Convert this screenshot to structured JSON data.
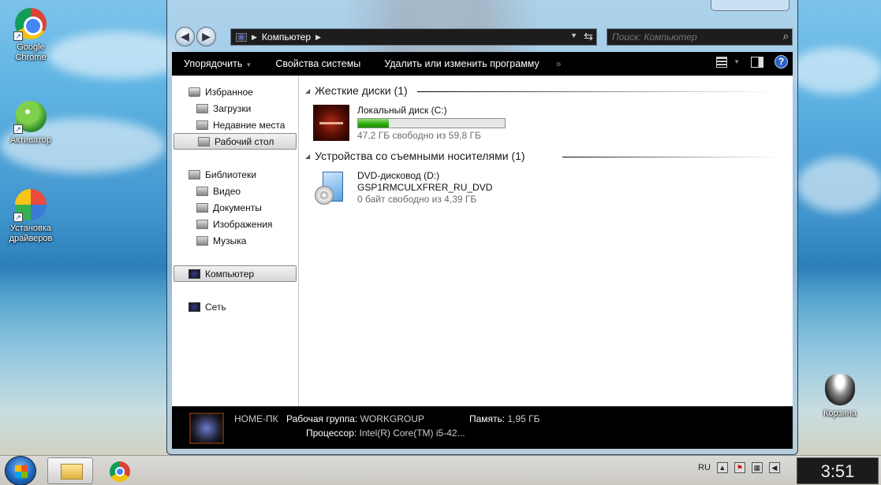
{
  "desktop": {
    "icons": [
      {
        "label": "Google Chrome",
        "icon": "chrome-icon"
      },
      {
        "label": "Активатор",
        "icon": "activator-icon"
      },
      {
        "label": "Установка драйверов",
        "icon": "driver-install-icon"
      },
      {
        "label": "Корзина",
        "icon": "recycle-bin-icon"
      }
    ]
  },
  "window": {
    "address": {
      "crumb": "Компьютер",
      "search_placeholder": "Поиск: Компьютер"
    },
    "toolbar": {
      "organize": "Упорядочить",
      "system_properties": "Свойства системы",
      "uninstall": "Удалить или изменить программу",
      "more": "»"
    },
    "nav": {
      "favorites": "Избранное",
      "downloads": "Загрузки",
      "recent": "Недавние места",
      "desktop": "Рабочий стол",
      "libraries": "Библиотеки",
      "video": "Видео",
      "documents": "Документы",
      "images": "Изображения",
      "music": "Музыка",
      "computer": "Компьютер",
      "network": "Сеть"
    },
    "groups": {
      "hdd_header": "Жесткие диски (1)",
      "removable_header": "Устройства со съемными носителями (1)"
    },
    "drives": {
      "c": {
        "name": "Локальный диск (C:)",
        "free": "47,2 ГБ свободно из 59,8 ГБ",
        "used_fraction": 0.21
      },
      "d": {
        "name": "DVD-дисковод (D:)",
        "label": "GSP1RMCULXFRER_RU_DVD",
        "free": "0 байт свободно из 4,39 ГБ"
      }
    },
    "details": {
      "pc_name": "HOME-ПК",
      "workgroup_label": "Рабочая группа:",
      "workgroup_value": "WORKGROUP",
      "memory_label": "Память:",
      "memory_value": "1,95 ГБ",
      "cpu_label": "Процессор:",
      "cpu_value": "Intel(R) Core(TM) i5-42..."
    }
  },
  "taskbar": {
    "language": "RU",
    "clock": "3:51"
  }
}
